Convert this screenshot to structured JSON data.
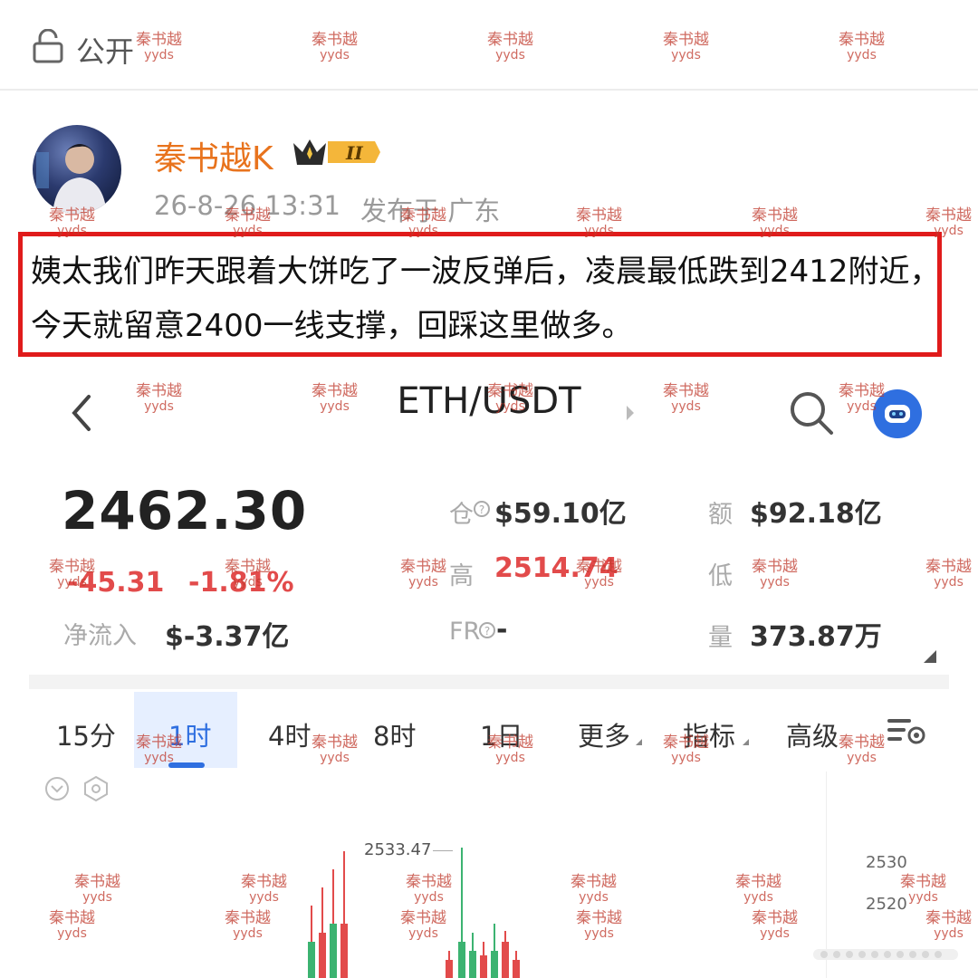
{
  "topbar": {
    "visibility_label": "公开",
    "icon": "lock-open-icon"
  },
  "post": {
    "username": "秦书越K",
    "vip_badge_text": "II",
    "time": "26-8-26 13:31",
    "location": "发布于 广东",
    "text": "姨太我们昨天跟着大饼吃了一波反弹后，凌晨最低跌到2412附近，今天就留意2400一线支撑，回踩这里做多。"
  },
  "app": {
    "pair": "ETH/USDT",
    "price": "2462.30",
    "change_abs": "-45.31",
    "change_pct": "-1.81%",
    "netflow_label": "净流入",
    "netflow_value": "$-3.37亿",
    "stats": {
      "open_interest_label": "仓",
      "open_interest_value": "$59.10亿",
      "turnover_label": "额",
      "turnover_value": "$92.18亿",
      "high_label": "高",
      "high_value": "2514.74",
      "low_label": "低",
      "low_value": "",
      "fr_label": "FR",
      "fr_value": "-",
      "volume_label": "量",
      "volume_value": "373.87万"
    },
    "tabs": [
      "15分",
      "1时",
      "4时",
      "8时",
      "1日",
      "更多",
      "指标",
      "高级"
    ],
    "active_tab": "1时",
    "chart": {
      "high_marker": "2533.47",
      "y_ticks": [
        "2530",
        "2520"
      ]
    }
  },
  "watermark": {
    "line1": "秦书越",
    "line2": "yyds"
  },
  "colors": {
    "accent_orange": "#e8731d",
    "down_red": "#e24b4b",
    "up_green": "#3cb371",
    "highlight_border": "#e01b1b",
    "active_tab_blue": "#2f6fe0"
  }
}
